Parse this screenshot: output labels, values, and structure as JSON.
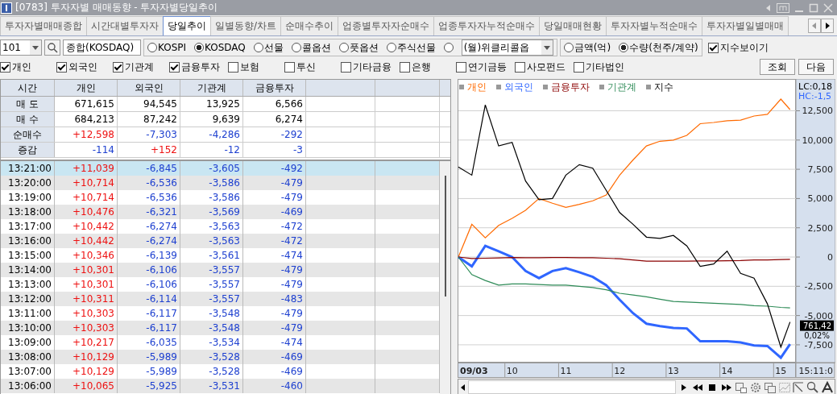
{
  "window": {
    "title": "[0783] 투자자별 매매동향 - 투자자별당일추이"
  },
  "tabs": [
    {
      "label": "투자자별매매종합",
      "selected": false
    },
    {
      "label": "시간대별투자자",
      "selected": false
    },
    {
      "label": "당일추이",
      "selected": true
    },
    {
      "label": "일별동향/차트",
      "selected": false
    },
    {
      "label": "순매수추이",
      "selected": false
    },
    {
      "label": "업종별투자자순매수",
      "selected": false
    },
    {
      "label": "업종투자자누적순매수",
      "selected": false
    },
    {
      "label": "당일매매현황",
      "selected": false
    },
    {
      "label": "투자자별누적순매수",
      "selected": false
    },
    {
      "label": "투자자별일별매매",
      "selected": false
    }
  ],
  "controls": {
    "code": "101",
    "name": "종합(KOSDAQ)",
    "markets": [
      {
        "label": "KOSPI",
        "selected": false
      },
      {
        "label": "KOSDAQ",
        "selected": true
      },
      {
        "label": "선물",
        "selected": false
      },
      {
        "label": "콜옵션",
        "selected": false
      },
      {
        "label": "풋옵션",
        "selected": false
      },
      {
        "label": "주식선물",
        "selected": false
      }
    ],
    "weekly": {
      "selected": false,
      "value": "(월)위클리콜옵"
    },
    "units": [
      {
        "label": "금액(억)",
        "selected": false
      },
      {
        "label": "수량(천주/계약)",
        "selected": true
      }
    ],
    "show_index": {
      "label": "지수보이기",
      "checked": true
    }
  },
  "investors": [
    {
      "label": "개인",
      "checked": true
    },
    {
      "label": "외국인",
      "checked": true
    },
    {
      "label": "기관계",
      "checked": true
    },
    {
      "label": "금융투자",
      "checked": true
    },
    {
      "label": "보험",
      "checked": false
    },
    {
      "label": "투신",
      "checked": false
    },
    {
      "label": "기타금융",
      "checked": false
    },
    {
      "label": "은행",
      "checked": false
    },
    {
      "label": "연기금등",
      "checked": false
    },
    {
      "label": "사모펀드",
      "checked": false
    },
    {
      "label": "기타법인",
      "checked": false
    }
  ],
  "buttons": [
    "조회",
    "다음"
  ],
  "table": {
    "columns": [
      "시간",
      "개인",
      "외국인",
      "기관계",
      "금융투자"
    ],
    "summary": [
      {
        "cells": [
          {
            "text": "매 도"
          },
          {
            "text": "671,615",
            "color": "#000000"
          },
          {
            "text": "94,545",
            "color": "#000000"
          },
          {
            "text": "13,925",
            "color": "#000000"
          },
          {
            "text": "6,566",
            "color": "#000000"
          }
        ]
      },
      {
        "cells": [
          {
            "text": "매 수"
          },
          {
            "text": "684,213",
            "color": "#000000"
          },
          {
            "text": "87,242",
            "color": "#000000"
          },
          {
            "text": "9,639",
            "color": "#000000"
          },
          {
            "text": "6,274",
            "color": "#000000"
          }
        ]
      },
      {
        "cells": [
          {
            "text": "순매수"
          },
          {
            "text": "+12,598",
            "color": "#ee1111"
          },
          {
            "text": "-7,303",
            "color": "#1e40d0"
          },
          {
            "text": "-4,286",
            "color": "#1e40d0"
          },
          {
            "text": "-292",
            "color": "#1e40d0"
          }
        ]
      },
      {
        "cells": [
          {
            "text": "증감"
          },
          {
            "text": "-114",
            "color": "#1e40d0"
          },
          {
            "text": "+152",
            "color": "#ee1111"
          },
          {
            "text": "-12",
            "color": "#1e40d0"
          },
          {
            "text": "-3",
            "color": "#1e40d0"
          }
        ]
      }
    ],
    "rows": [
      {
        "selected": true,
        "cells": [
          {
            "text": "13:21:00",
            "color": "#000000"
          },
          {
            "text": "+11,039",
            "color": "#ee1111"
          },
          {
            "text": "-6,845",
            "color": "#1e40d0"
          },
          {
            "text": "-3,605",
            "color": "#1e40d0"
          },
          {
            "text": "-492",
            "color": "#1e40d0"
          }
        ]
      },
      {
        "selected": false,
        "cells": [
          {
            "text": "13:20:00",
            "color": "#000000"
          },
          {
            "text": "+10,714",
            "color": "#ee1111"
          },
          {
            "text": "-6,536",
            "color": "#1e40d0"
          },
          {
            "text": "-3,586",
            "color": "#1e40d0"
          },
          {
            "text": "-479",
            "color": "#1e40d0"
          }
        ]
      },
      {
        "selected": false,
        "cells": [
          {
            "text": "13:19:00",
            "color": "#000000"
          },
          {
            "text": "+10,714",
            "color": "#ee1111"
          },
          {
            "text": "-6,536",
            "color": "#1e40d0"
          },
          {
            "text": "-3,586",
            "color": "#1e40d0"
          },
          {
            "text": "-479",
            "color": "#1e40d0"
          }
        ]
      },
      {
        "selected": false,
        "cells": [
          {
            "text": "13:18:00",
            "color": "#000000"
          },
          {
            "text": "+10,476",
            "color": "#ee1111"
          },
          {
            "text": "-6,321",
            "color": "#1e40d0"
          },
          {
            "text": "-3,569",
            "color": "#1e40d0"
          },
          {
            "text": "-469",
            "color": "#1e40d0"
          }
        ]
      },
      {
        "selected": false,
        "cells": [
          {
            "text": "13:17:00",
            "color": "#000000"
          },
          {
            "text": "+10,442",
            "color": "#ee1111"
          },
          {
            "text": "-6,274",
            "color": "#1e40d0"
          },
          {
            "text": "-3,563",
            "color": "#1e40d0"
          },
          {
            "text": "-472",
            "color": "#1e40d0"
          }
        ]
      },
      {
        "selected": false,
        "cells": [
          {
            "text": "13:16:00",
            "color": "#000000"
          },
          {
            "text": "+10,442",
            "color": "#ee1111"
          },
          {
            "text": "-6,274",
            "color": "#1e40d0"
          },
          {
            "text": "-3,563",
            "color": "#1e40d0"
          },
          {
            "text": "-472",
            "color": "#1e40d0"
          }
        ]
      },
      {
        "selected": false,
        "cells": [
          {
            "text": "13:15:00",
            "color": "#000000"
          },
          {
            "text": "+10,346",
            "color": "#ee1111"
          },
          {
            "text": "-6,139",
            "color": "#1e40d0"
          },
          {
            "text": "-3,561",
            "color": "#1e40d0"
          },
          {
            "text": "-474",
            "color": "#1e40d0"
          }
        ]
      },
      {
        "selected": false,
        "cells": [
          {
            "text": "13:14:00",
            "color": "#000000"
          },
          {
            "text": "+10,301",
            "color": "#ee1111"
          },
          {
            "text": "-6,106",
            "color": "#1e40d0"
          },
          {
            "text": "-3,557",
            "color": "#1e40d0"
          },
          {
            "text": "-479",
            "color": "#1e40d0"
          }
        ]
      },
      {
        "selected": false,
        "cells": [
          {
            "text": "13:13:00",
            "color": "#000000"
          },
          {
            "text": "+10,301",
            "color": "#ee1111"
          },
          {
            "text": "-6,106",
            "color": "#1e40d0"
          },
          {
            "text": "-3,557",
            "color": "#1e40d0"
          },
          {
            "text": "-479",
            "color": "#1e40d0"
          }
        ]
      },
      {
        "selected": false,
        "cells": [
          {
            "text": "13:12:00",
            "color": "#000000"
          },
          {
            "text": "+10,311",
            "color": "#ee1111"
          },
          {
            "text": "-6,114",
            "color": "#1e40d0"
          },
          {
            "text": "-3,557",
            "color": "#1e40d0"
          },
          {
            "text": "-483",
            "color": "#1e40d0"
          }
        ]
      },
      {
        "selected": false,
        "cells": [
          {
            "text": "13:11:00",
            "color": "#000000"
          },
          {
            "text": "+10,303",
            "color": "#ee1111"
          },
          {
            "text": "-6,117",
            "color": "#1e40d0"
          },
          {
            "text": "-3,548",
            "color": "#1e40d0"
          },
          {
            "text": "-479",
            "color": "#1e40d0"
          }
        ]
      },
      {
        "selected": false,
        "cells": [
          {
            "text": "13:10:00",
            "color": "#000000"
          },
          {
            "text": "+10,303",
            "color": "#ee1111"
          },
          {
            "text": "-6,117",
            "color": "#1e40d0"
          },
          {
            "text": "-3,548",
            "color": "#1e40d0"
          },
          {
            "text": "-479",
            "color": "#1e40d0"
          }
        ]
      },
      {
        "selected": false,
        "cells": [
          {
            "text": "13:09:00",
            "color": "#000000"
          },
          {
            "text": "+10,217",
            "color": "#ee1111"
          },
          {
            "text": "-6,035",
            "color": "#1e40d0"
          },
          {
            "text": "-3,534",
            "color": "#1e40d0"
          },
          {
            "text": "-474",
            "color": "#1e40d0"
          }
        ]
      },
      {
        "selected": false,
        "cells": [
          {
            "text": "13:08:00",
            "color": "#000000"
          },
          {
            "text": "+10,129",
            "color": "#ee1111"
          },
          {
            "text": "-5,989",
            "color": "#1e40d0"
          },
          {
            "text": "-3,528",
            "color": "#1e40d0"
          },
          {
            "text": "-469",
            "color": "#1e40d0"
          }
        ]
      },
      {
        "selected": false,
        "cells": [
          {
            "text": "13:07:00",
            "color": "#000000"
          },
          {
            "text": "+10,129",
            "color": "#ee1111"
          },
          {
            "text": "-5,989",
            "color": "#1e40d0"
          },
          {
            "text": "-3,528",
            "color": "#1e40d0"
          },
          {
            "text": "-469",
            "color": "#1e40d0"
          }
        ]
      },
      {
        "selected": false,
        "cells": [
          {
            "text": "13:06:00",
            "color": "#000000"
          },
          {
            "text": "+10,065",
            "color": "#ee1111"
          },
          {
            "text": "-5,925",
            "color": "#1e40d0"
          },
          {
            "text": "-3,531",
            "color": "#1e40d0"
          },
          {
            "text": "-460",
            "color": "#1e40d0"
          }
        ]
      }
    ]
  },
  "chart": {
    "lc": "LC:0,18",
    "hc": "HC:-1,5",
    "price": "761,42",
    "change": "0,02%",
    "date": "09/03",
    "time": "15:11:0",
    "chart_data": {
      "type": "line",
      "grid": true,
      "xlim": [
        9,
        15.28
      ],
      "ylim": [
        -9020,
        15220
      ],
      "x": [
        9,
        9.25,
        9.5,
        9.75,
        10,
        10.25,
        10.5,
        10.75,
        11,
        11.25,
        11.5,
        11.75,
        12,
        12.25,
        12.5,
        12.75,
        13,
        13.25,
        13.5,
        13.75,
        14,
        14.25,
        14.5,
        14.75,
        15,
        15.17
      ],
      "xticks": [
        {
          "value": 10,
          "label": "10"
        },
        {
          "value": 11,
          "label": "11"
        },
        {
          "value": 12,
          "label": "12"
        },
        {
          "value": 13,
          "label": "13"
        },
        {
          "value": 14,
          "label": "14"
        },
        {
          "value": 15,
          "label": "15"
        }
      ],
      "yticks": [
        {
          "value": 12500,
          "label": "12,500"
        },
        {
          "value": 10000,
          "label": "10,000"
        },
        {
          "value": 7500,
          "label": "7,500"
        },
        {
          "value": 5000,
          "label": "5,000"
        },
        {
          "value": 2500,
          "label": "2,500"
        },
        {
          "value": 0,
          "label": "0"
        },
        {
          "value": -2500,
          "label": "-2,500"
        },
        {
          "value": -5000,
          "label": "-5,000"
        },
        {
          "value": -7500,
          "label": "-7,500"
        }
      ],
      "series": [
        {
          "name": "개인",
          "color": "#ff6a00",
          "values": [
            0,
            2800,
            1650,
            2700,
            3300,
            4000,
            5000,
            4600,
            4250,
            4500,
            4800,
            5300,
            7000,
            8300,
            9500,
            9900,
            10000,
            10400,
            11400,
            11500,
            11650,
            11700,
            12050,
            12200,
            13500,
            12600
          ]
        },
        {
          "name": "외국인",
          "color": "#2f66ff",
          "values": [
            0,
            -800,
            950,
            500,
            0,
            -1200,
            -1800,
            -1200,
            -950,
            -1300,
            -1700,
            -2400,
            -3650,
            -4800,
            -5700,
            -5900,
            -6050,
            -6100,
            -7200,
            -7200,
            -7200,
            -7300,
            -7550,
            -7600,
            -8600,
            -7450
          ]
        },
        {
          "name": "금융투자",
          "color": "#8b0000",
          "values": [
            0,
            -120,
            -100,
            -80,
            -50,
            -60,
            -60,
            -50,
            -50,
            -60,
            -60,
            -100,
            -150,
            -250,
            -350,
            -350,
            -350,
            -350,
            -330,
            -330,
            -320,
            -300,
            -250,
            -250,
            -220,
            -200
          ]
        },
        {
          "name": "기관계",
          "color": "#2e8b57",
          "values": [
            0,
            -1500,
            -2000,
            -2400,
            -2300,
            -2300,
            -2350,
            -2400,
            -2400,
            -2500,
            -2600,
            -2800,
            -3100,
            -3250,
            -3400,
            -3600,
            -3800,
            -3850,
            -3900,
            -3950,
            -4000,
            -4050,
            -4150,
            -4200,
            -4300,
            -4350
          ]
        },
        {
          "name": "지수",
          "color": "#000000",
          "values": [
            7700,
            7000,
            13000,
            9500,
            9800,
            6500,
            4900,
            5000,
            7000,
            7900,
            7600,
            5700,
            3800,
            2800,
            1700,
            1600,
            1850,
            950,
            -800,
            -600,
            500,
            -1400,
            -1800,
            -4000,
            -7700,
            -5550
          ]
        }
      ]
    }
  }
}
